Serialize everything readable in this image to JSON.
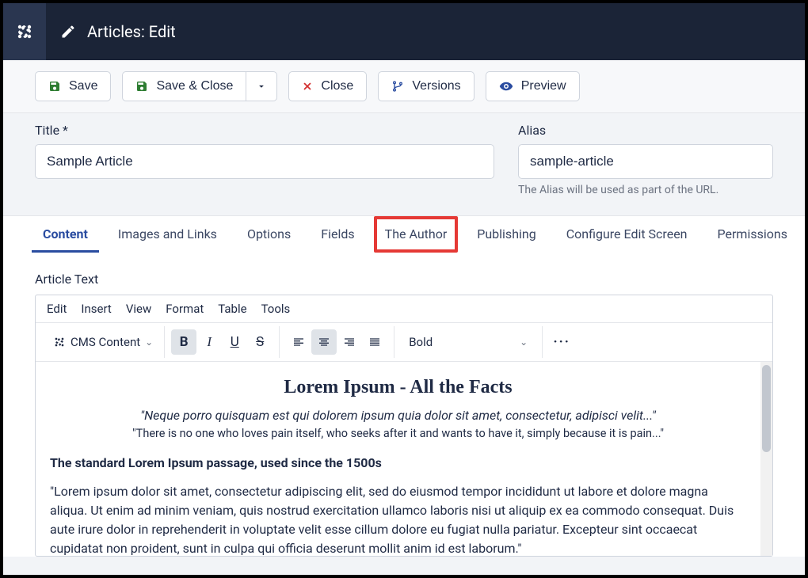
{
  "header": {
    "title": "Articles: Edit"
  },
  "toolbar": {
    "save": "Save",
    "save_close": "Save & Close",
    "close": "Close",
    "versions": "Versions",
    "preview": "Preview"
  },
  "form": {
    "title_label": "Title *",
    "title_value": "Sample Article",
    "alias_label": "Alias",
    "alias_value": "sample-article",
    "alias_help": "The Alias will be used as part of the URL."
  },
  "tabs": [
    "Content",
    "Images and Links",
    "Options",
    "Fields",
    "The Author",
    "Publishing",
    "Configure Edit Screen",
    "Permissions"
  ],
  "active_tab_index": 0,
  "highlight_tab_index": 4,
  "editor": {
    "section_label": "Article Text",
    "menu": [
      "Edit",
      "Insert",
      "View",
      "Format",
      "Table",
      "Tools"
    ],
    "cms_label": "CMS Content",
    "font_weight": "Bold",
    "body": {
      "title": "Lorem Ipsum - All the Facts",
      "sub1": "\"Neque porro quisquam est qui dolorem ipsum quia dolor sit amet, consectetur, adipisci velit...\"",
      "sub2": "\"There is no one who loves pain itself, who seeks after it and wants to have it, simply because it is pain...\"",
      "heading": "The standard Lorem Ipsum passage, used since the 1500s",
      "para": "\"Lorem ipsum dolor sit amet, consectetur adipiscing elit, sed do eiusmod tempor incididunt ut labore et dolore magna aliqua. Ut enim ad minim veniam, quis nostrud exercitation ullamco laboris nisi ut aliquip ex ea commodo consequat. Duis aute irure dolor in reprehenderit in voluptate velit esse cillum dolore eu fugiat nulla pariatur. Excepteur sint occaecat cupidatat non proident, sunt in culpa qui officia deserunt mollit anim id est laborum.\""
    }
  }
}
